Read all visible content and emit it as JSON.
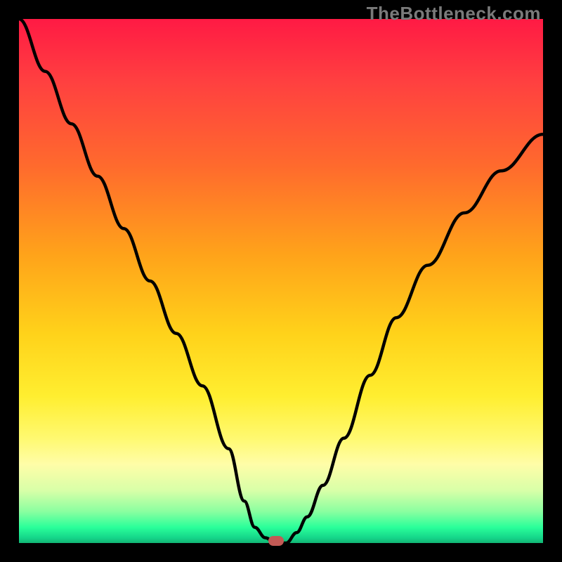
{
  "watermark": "TheBottleneck.com",
  "colors": {
    "frame": "#000000",
    "curve_stroke": "#000000",
    "marker": "#c25a55"
  },
  "chart_data": {
    "type": "line",
    "title": "",
    "xlabel": "",
    "ylabel": "",
    "xlim": [
      0,
      100
    ],
    "ylim": [
      0,
      100
    ],
    "grid": false,
    "series": [
      {
        "name": "bottleneck-curve",
        "x": [
          0,
          5,
          10,
          15,
          20,
          25,
          30,
          35,
          40,
          43,
          45,
          47,
          49,
          51,
          53,
          55,
          58,
          62,
          67,
          72,
          78,
          85,
          92,
          100
        ],
        "y": [
          100,
          90,
          80,
          70,
          60,
          50,
          40,
          30,
          18,
          8,
          3,
          1,
          0,
          0,
          2,
          5,
          11,
          20,
          32,
          43,
          53,
          63,
          71,
          78
        ]
      }
    ],
    "marker": {
      "x": 49,
      "y": 0
    },
    "background_gradient": [
      {
        "stop": 0.0,
        "color": "#ff1a44"
      },
      {
        "stop": 0.28,
        "color": "#ff6a2d"
      },
      {
        "stop": 0.6,
        "color": "#ffd21a"
      },
      {
        "stop": 0.85,
        "color": "#fffda8"
      },
      {
        "stop": 0.97,
        "color": "#2aff9a"
      },
      {
        "stop": 1.0,
        "color": "#12b573"
      }
    ]
  }
}
